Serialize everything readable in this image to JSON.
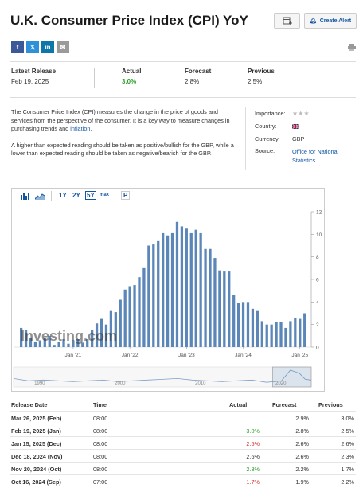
{
  "title": "U.K. Consumer Price Index (CPI) YoY",
  "create_alert": "Create Alert",
  "share": [
    {
      "name": "facebook-button",
      "glyph": "f",
      "color": "#3b5998"
    },
    {
      "name": "twitter-button",
      "glyph": "𝕏",
      "color": "#2e90d8"
    },
    {
      "name": "linkedin-button",
      "glyph": "in",
      "color": "#0e76a8"
    },
    {
      "name": "email-button",
      "glyph": "✉",
      "color": "#9a9a9a"
    }
  ],
  "release": {
    "latest_label": "Latest Release",
    "latest_date": "Feb 19, 2025",
    "actual_label": "Actual",
    "actual": "3.0%",
    "forecast_label": "Forecast",
    "forecast": "2.8%",
    "previous_label": "Previous",
    "previous": "2.5%"
  },
  "description": {
    "p1_before": "The Consumer Price Index (CPI) measures the change in the price of goods and services from the perspective of the consumer. It is a key way to measure changes in purchasing trends and ",
    "p1_link": "inflation",
    "p1_after": ".",
    "p2": "A higher than expected reading should be taken as positive/bullish for the GBP, while a lower than expected reading should be taken as negative/bearish for the GBP."
  },
  "info": {
    "importance_label": "Importance:",
    "country_label": "Country:",
    "currency_label": "Currency:",
    "currency": "GBP",
    "source_label": "Source:",
    "source_line1": "Office for National",
    "source_line2": "Statistics"
  },
  "toolbar": {
    "r1": "1Y",
    "r2": "2Y",
    "r3": "5Y",
    "r4": "max",
    "p": "P"
  },
  "chart_data": {
    "type": "bar",
    "watermark": "Investing.com",
    "ylim": [
      0,
      12
    ],
    "yticks": [
      "0",
      "2",
      "4",
      "6",
      "8",
      "10",
      "12"
    ],
    "xtick_labels": [
      "Jan '21",
      "Jan '22",
      "Jan '23",
      "Jan '24",
      "Jan '25"
    ],
    "start": "Feb 2020",
    "values": [
      1.7,
      1.5,
      0.8,
      0.5,
      0.6,
      0.8,
      1.0,
      0.2,
      0.5,
      0.7,
      0.3,
      0.6,
      0.7,
      0.4,
      0.7,
      1.5,
      2.1,
      2.5,
      2.0,
      3.2,
      3.1,
      4.2,
      5.1,
      5.4,
      5.5,
      6.2,
      7.0,
      9.0,
      9.1,
      9.4,
      10.1,
      9.9,
      10.1,
      11.1,
      10.7,
      10.5,
      10.1,
      10.4,
      10.1,
      8.7,
      8.7,
      7.9,
      6.8,
      6.7,
      6.7,
      4.6,
      3.9,
      4.0,
      4.0,
      3.4,
      3.2,
      2.3,
      2.0,
      2.0,
      2.2,
      2.2,
      1.7,
      2.3,
      2.6,
      2.5,
      3.0
    ],
    "navigator_labels": [
      "1990",
      "2000",
      "2010",
      "2020"
    ]
  },
  "table": {
    "headers": [
      "Release Date",
      "Time",
      "Actual",
      "Forecast",
      "Previous"
    ],
    "rows": [
      {
        "date": "Mar 26, 2025 (Feb)",
        "time": "08:00",
        "actual": "",
        "actual_color": "#333333",
        "forecast": "2.9%",
        "previous": "3.0%"
      },
      {
        "date": "Feb 19, 2025 (Jan)",
        "time": "08:00",
        "actual": "3.0%",
        "actual_color": "#2ca02c",
        "forecast": "2.8%",
        "previous": "2.5%"
      },
      {
        "date": "Jan 15, 2025 (Dec)",
        "time": "08:00",
        "actual": "2.5%",
        "actual_color": "#d62728",
        "forecast": "2.6%",
        "previous": "2.6%"
      },
      {
        "date": "Dec 18, 2024 (Nov)",
        "time": "08:00",
        "actual": "2.6%",
        "actual_color": "#333333",
        "forecast": "2.6%",
        "previous": "2.3%"
      },
      {
        "date": "Nov 20, 2024 (Oct)",
        "time": "08:00",
        "actual": "2.3%",
        "actual_color": "#2ca02c",
        "forecast": "2.2%",
        "previous": "1.7%"
      },
      {
        "date": "Oct 16, 2024 (Sep)",
        "time": "07:00",
        "actual": "1.7%",
        "actual_color": "#d62728",
        "forecast": "1.9%",
        "previous": "2.2%"
      }
    ]
  }
}
